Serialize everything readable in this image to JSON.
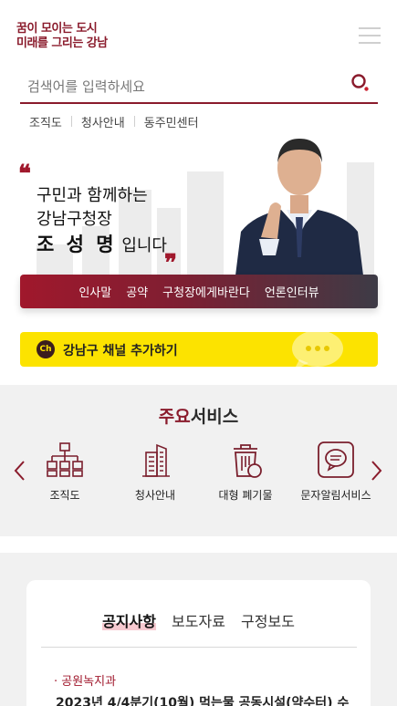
{
  "header": {
    "logo_line1": "꿈이 모이는 도시",
    "logo_line2": "미래를 그리는 강남",
    "menu_icon": "hamburger-menu-icon"
  },
  "search": {
    "placeholder": "검색어를 입력하세요",
    "value": "",
    "icon": "search-icon"
  },
  "quick_links": [
    "조직도",
    "청사안내",
    "동주민센터"
  ],
  "hero": {
    "line1": "구민과 함께하는",
    "line2": "강남구청장",
    "name": "조 성 명",
    "line3_suffix": " 입니다",
    "menu": [
      "인사말",
      "공약",
      "구청장에게바란다",
      "언론인터뷰"
    ]
  },
  "kakao": {
    "badge": "Ch",
    "label": "강남구 채널 추가하기"
  },
  "services": {
    "title_accent": "주요",
    "title_rest": "서비스",
    "items": [
      {
        "label": "조직도",
        "icon": "org-chart-icon"
      },
      {
        "label": "청사안내",
        "icon": "building-icon"
      },
      {
        "label": "대형 폐기물",
        "icon": "trash-can-icon"
      },
      {
        "label": "문자알림서비스",
        "icon": "message-icon"
      }
    ]
  },
  "notice": {
    "tabs": [
      "공지사항",
      "보도자료",
      "구정보도"
    ],
    "active_tab": "공지사항",
    "dept": "· 공원녹지과",
    "title": "2023년 4/4분기(10월) 먹는물 공동시설(약수터) 수"
  },
  "colors": {
    "brand": "#8a1b2c",
    "accent": "#a0182c",
    "kakao": "#fce300"
  }
}
